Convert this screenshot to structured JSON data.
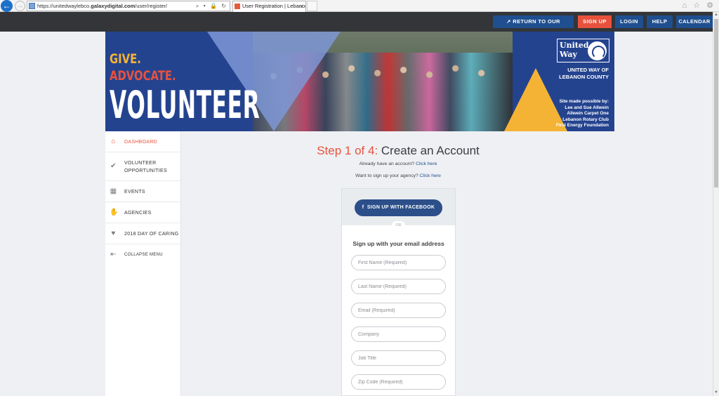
{
  "browser": {
    "url_prefix": "https://unitedwaylebco.",
    "url_domain": "galaxydigital.com",
    "url_path": "/user/register/",
    "addr_controls": "⌕ ▾ 🔒 ↻",
    "tab_title": "User Registration | Lebanon...",
    "tab_close": "×",
    "back": "←",
    "forward": "→",
    "icons": "⌂ ☆ ⚙"
  },
  "topnav": {
    "return_label": "RETURN TO OUR WEBSITE",
    "signup_label": "SIGN UP",
    "login_label": "LOGIN",
    "help_label": "HELP",
    "calendar_label": "CALENDAR",
    "colors": {
      "bar": "#333538",
      "button": "#1f4f8f",
      "signup": "#e8523d"
    }
  },
  "banner": {
    "give": "GIVE.",
    "advocate": "ADVOCATE.",
    "volunteer": "VOLUNTEER",
    "logo_line1": "United",
    "logo_line2": "Way",
    "org_line1": "UNITED WAY OF",
    "org_line2": "LEBANON COUNTY",
    "possible_line1": "Site made possible by:",
    "possible_line2": "Lee and Sue Allwein",
    "possible_line3": "Allwein Carpet One",
    "possible_line4": "Lebanon Rotary Club",
    "possible_line5": "First Energy Foundation"
  },
  "sidebar": {
    "items": [
      {
        "label": "DASHBOARD",
        "icon": "home-icon"
      },
      {
        "label_line1": "VOLUNTEER",
        "label_line2": "OPPORTUNITIES",
        "icon": "check-circle-icon"
      },
      {
        "label": "EVENTS",
        "icon": "calendar-icon"
      },
      {
        "label": "AGENCIES",
        "icon": "hands-icon"
      },
      {
        "label": "2018 DAY OF CARING",
        "icon": "heart-hands-icon"
      },
      {
        "label": "COLLAPSE MENU",
        "icon": "collapse-icon"
      }
    ]
  },
  "main": {
    "step_label": "Step 1 of 4:",
    "step_title": "Create an Account",
    "have_account": "Already have an account?",
    "have_account_link": "Click here",
    "agency_text": "Want to sign up your agency?",
    "agency_link": "Click here",
    "facebook_label": "SIGN UP WITH FACEBOOK",
    "facebook_icon": "f",
    "or_text": "OR",
    "email_heading": "Sign up with your email address",
    "fields": {
      "first_name": "First Name (Required)",
      "last_name": "Last Name (Required)",
      "email": "Email (Required)",
      "company": "Company",
      "job_title": "Job Title",
      "zip": "Zip Code (Required)"
    }
  }
}
